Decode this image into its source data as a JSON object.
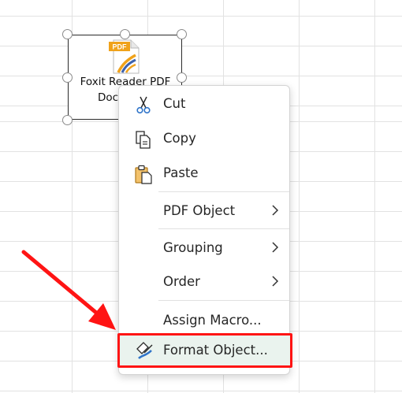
{
  "embedded_object": {
    "label_line1": "Foxit Reader PDF",
    "label_line2": "Document",
    "icon": "pdf-document-icon",
    "icon_badge": "PDF",
    "badge_color": "#f0a21a"
  },
  "context_menu": {
    "items": [
      {
        "label": "Cut",
        "icon": "scissors-icon"
      },
      {
        "label": "Copy",
        "icon": "copy-icon"
      },
      {
        "label": "Paste",
        "icon": "paste-icon"
      },
      {
        "label": "PDF Object",
        "submenu": true
      },
      {
        "label": "Grouping",
        "submenu": true
      },
      {
        "label": "Order",
        "submenu": true
      },
      {
        "label": "Assign Macro..."
      },
      {
        "label": "Format Object...",
        "icon": "format-object-icon",
        "highlighted": true
      }
    ]
  },
  "annotation": {
    "arrow_color": "#ff1414",
    "highlight_color": "#ff1414"
  }
}
